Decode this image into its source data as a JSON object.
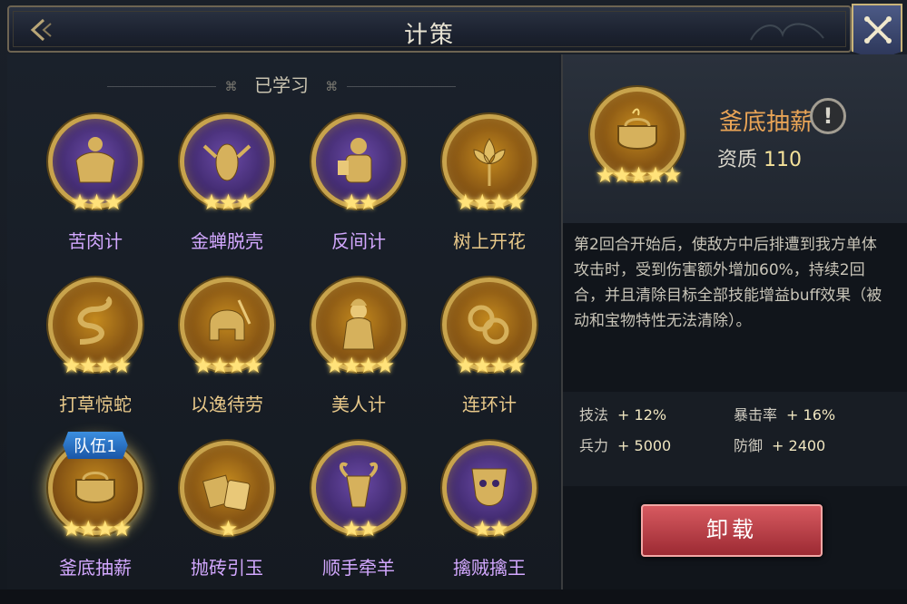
{
  "title": "计策",
  "section_label": "已学习",
  "colors": {
    "accent_gold": "#e9a456",
    "purple_text": "#d3a8ff",
    "unload_red": "#b9363e"
  },
  "grid": [
    {
      "name": "苦肉计",
      "stars": 3,
      "bg": "purple",
      "icon": "muscle-man-icon"
    },
    {
      "name": "金蝉脱壳",
      "stars": 3,
      "bg": "purple",
      "icon": "cicada-icon"
    },
    {
      "name": "反间计",
      "stars": 2,
      "bg": "purple",
      "icon": "scholar-icon"
    },
    {
      "name": "树上开花",
      "stars": 4,
      "bg": "gold",
      "icon": "lotus-icon"
    },
    {
      "name": "打草惊蛇",
      "stars": 4,
      "bg": "gold",
      "icon": "snake-icon"
    },
    {
      "name": "以逸待劳",
      "stars": 4,
      "bg": "gold",
      "icon": "helmet-icon"
    },
    {
      "name": "美人计",
      "stars": 4,
      "bg": "gold",
      "icon": "beauty-icon"
    },
    {
      "name": "连环计",
      "stars": 4,
      "bg": "gold",
      "icon": "chain-rings-icon"
    },
    {
      "name": "釜底抽薪",
      "stars": 4,
      "bg": "gold",
      "icon": "cauldron-icon",
      "team": "队伍1",
      "selected": true
    },
    {
      "name": "抛砖引玉",
      "stars": 1,
      "bg": "gold",
      "icon": "brick-jade-icon"
    },
    {
      "name": "顺手牵羊",
      "stars": 2,
      "bg": "purple",
      "icon": "goat-icon"
    },
    {
      "name": "擒贼擒王",
      "stars": 2,
      "bg": "purple",
      "icon": "warrior-mask-icon"
    }
  ],
  "detail": {
    "name": "釜底抽薪",
    "quality_label": "资质",
    "quality_value": "110",
    "stars": 5,
    "info_glyph": "!",
    "description": "第2回合开始后，使敌方中后排遭到我方单体攻击时，受到伤害额外增加60%，持续2回合，并且清除目标全部技能增益buff效果（被动和宝物特性无法清除）。",
    "stats": [
      {
        "label": "技法",
        "value": "+ 12%"
      },
      {
        "label": "暴击率",
        "value": "+ 16%"
      },
      {
        "label": "兵力",
        "value": "+ 5000"
      },
      {
        "label": "防御",
        "value": "+ 2400"
      }
    ],
    "unload_label": "卸载"
  }
}
